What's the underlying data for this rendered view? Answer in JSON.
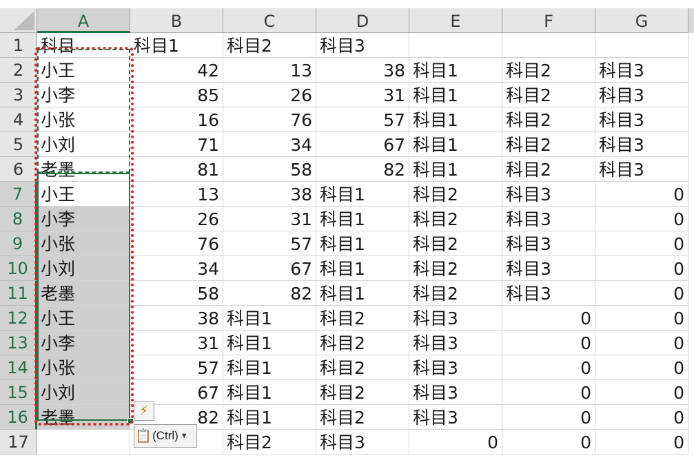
{
  "columns": [
    "A",
    "B",
    "C",
    "D",
    "E",
    "F",
    "G"
  ],
  "rows": [
    [
      "科目",
      "科目1",
      "科目2",
      "科目3",
      "",
      "",
      ""
    ],
    [
      "小王",
      "42",
      "13",
      "38",
      "科目1",
      "科目2",
      "科目3"
    ],
    [
      "小李",
      "85",
      "26",
      "31",
      "科目1",
      "科目2",
      "科目3"
    ],
    [
      "小张",
      "16",
      "76",
      "57",
      "科目1",
      "科目2",
      "科目3"
    ],
    [
      "小刘",
      "71",
      "34",
      "67",
      "科目1",
      "科目2",
      "科目3"
    ],
    [
      "老墨",
      "81",
      "58",
      "82",
      "科目1",
      "科目2",
      "科目3"
    ],
    [
      "小王",
      "13",
      "38",
      "科目1",
      "科目2",
      "科目3",
      "0"
    ],
    [
      "小李",
      "26",
      "31",
      "科目1",
      "科目2",
      "科目3",
      "0"
    ],
    [
      "小张",
      "76",
      "57",
      "科目1",
      "科目2",
      "科目3",
      "0"
    ],
    [
      "小刘",
      "34",
      "67",
      "科目1",
      "科目2",
      "科目3",
      "0"
    ],
    [
      "老墨",
      "58",
      "82",
      "科目1",
      "科目2",
      "科目3",
      "0"
    ],
    [
      "小王",
      "38",
      "科目1",
      "科目2",
      "科目3",
      "0",
      "0"
    ],
    [
      "小李",
      "31",
      "科目1",
      "科目2",
      "科目3",
      "0",
      "0"
    ],
    [
      "小张",
      "57",
      "科目1",
      "科目2",
      "科目3",
      "0",
      "0"
    ],
    [
      "小刘",
      "67",
      "科目1",
      "科目2",
      "科目3",
      "0",
      "0"
    ],
    [
      "老墨",
      "82",
      "科目1",
      "科目2",
      "科目3",
      "0",
      "0"
    ],
    [
      "",
      "",
      "科目2",
      "科目3",
      "0",
      "0",
      "0"
    ]
  ],
  "selection": {
    "selected_column": "A",
    "selected_rows_from": 7,
    "selected_rows_to": 16,
    "copy_marquee_rows_from": 2,
    "copy_marquee_rows_to": 6
  },
  "paste_options": {
    "label": "(Ctrl)",
    "icon": "clipboard-icon",
    "quick_icon": "flash-fill-icon"
  },
  "colors": {
    "selection_green": "#217346",
    "highlight_red": "#e02020",
    "selected_fill": "#cfcfcf",
    "header_bg": "#e6e6e6"
  }
}
